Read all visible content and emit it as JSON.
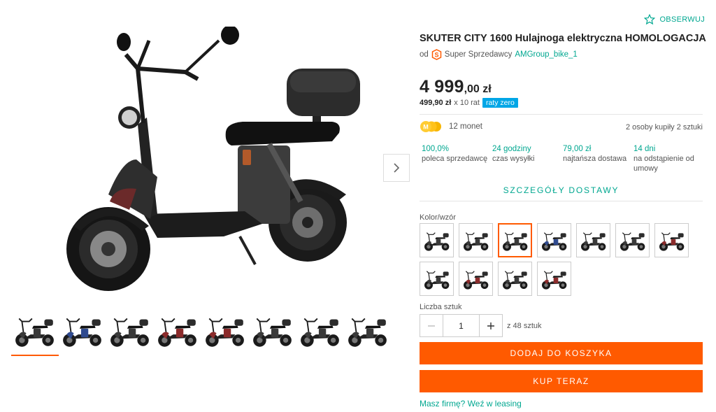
{
  "product": {
    "title": "SKUTER CITY 1600 Hulajnoga elektryczna HOMOLOGACJA",
    "follow_label": "OBSERWUJ",
    "seller_prefix": "od",
    "seller_badge": "Super Sprzedawcy",
    "seller_name": "AMGroup_bike_1"
  },
  "price": {
    "main": "4 999",
    "cents_currency": ",00 zł",
    "installment_amount": "499,90 zł",
    "installment_count": "x 10 rat",
    "installment_badge": "raty zero"
  },
  "coins": {
    "label": "12 monet"
  },
  "bought": "2 osoby kupiły 2 sztuki",
  "stats": [
    {
      "value": "100,0%",
      "label": "poleca sprzedawcę"
    },
    {
      "value": "24 godziny",
      "label": "czas wysyłki"
    },
    {
      "value": "79,00 zł",
      "label": "najtańsza dostawa"
    },
    {
      "value": "14 dni",
      "label": "na odstąpienie od umowy"
    }
  ],
  "delivery_details": "SZCZEGÓŁY DOSTAWY",
  "variants": {
    "label": "Kolor/wzór",
    "selected_index": 2,
    "colors": [
      "#3a3a3a",
      "#3a3a3a",
      "#3a3a3a",
      "#2f4a8f",
      "#3a3a3a",
      "#3a3a3a",
      "#8b2b2b",
      "#3a3a3a",
      "#8b2b2b",
      "#3a3a3a",
      "#8b2b2b"
    ]
  },
  "quantity": {
    "label": "Liczba sztuk",
    "value": "1",
    "available": "z 48 sztuk"
  },
  "buttons": {
    "add_to_cart": "DODAJ DO KOSZYKA",
    "buy_now": "KUP TERAZ"
  },
  "leasing_link": "Masz firmę? Weź w leasing",
  "gallery": {
    "active_index": 0,
    "thumb_colors": [
      "#3a3a3a",
      "#2f4a8f",
      "#3a3a3a",
      "#8b2b2b",
      "#8b2b2b",
      "#3a3a3a",
      "#3a3a3a",
      "#3a3a3a"
    ]
  },
  "colors": {
    "accent": "#ff5a00",
    "link": "#00a790",
    "badge": "#00a6e6"
  }
}
